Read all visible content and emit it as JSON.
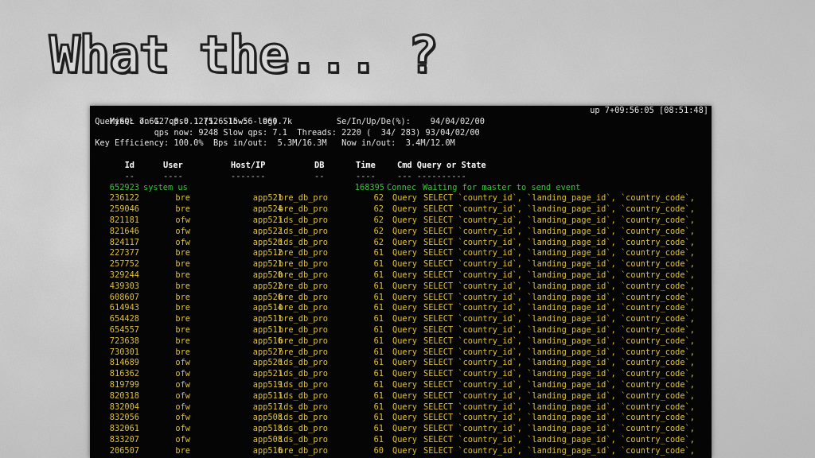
{
  "slide": {
    "title": "What the... ?"
  },
  "terminal": {
    "header": {
      "line1_left": "MySQL on 127.0.0.1 (5.6.15-56-log)",
      "line1_right": "up 7+09:56:05 [08:51:48]",
      "line2": " Queries: 7.6G  qps: 12712 Slow:   960.7k         Se/In/Up/De(%):    94/04/02/00",
      "line3": "             qps now: 9248 Slow qps: 7.1  Threads: 2220 (  34/ 283) 93/04/02/00",
      "line4": " Key Efficiency: 100.0%  Bps in/out:  5.3M/16.3M   Now in/out:  3.4M/12.0M"
    },
    "columns": {
      "id": "Id",
      "user": "User",
      "host": "Host/IP",
      "db": "DB",
      "time": "Time",
      "cmd_state": "Cmd Query or State"
    },
    "separators": {
      "id": "--",
      "user": "----",
      "host": "-------",
      "db": "--",
      "time": "----",
      "cmd_state": "--- ----------"
    },
    "system_row": {
      "id": "652923",
      "user": "system us",
      "time": "168395",
      "cmd": "Connec",
      "state": "Waiting for master to send event"
    },
    "rows": [
      {
        "id": "236122",
        "user": "bre",
        "host": "app521",
        "db": "bre_db_pro",
        "time": "62",
        "cmd": "Query",
        "query": "SELECT `country_id`, `landing_page_id`, `country_code`,"
      },
      {
        "id": "259046",
        "user": "bre",
        "host": "app524",
        "db": "bre_db_pro",
        "time": "62",
        "cmd": "Query",
        "query": "SELECT `country_id`, `landing_page_id`, `country_code`,"
      },
      {
        "id": "821181",
        "user": "ofw",
        "host": "app521",
        "db": "ids_db_pro",
        "time": "62",
        "cmd": "Query",
        "query": "SELECT `country_id`, `landing_page_id`, `country_code`,"
      },
      {
        "id": "821646",
        "user": "ofw",
        "host": "app522",
        "db": "ids_db_pro",
        "time": "62",
        "cmd": "Query",
        "query": "SELECT `country_id`, `landing_page_id`, `country_code`,"
      },
      {
        "id": "824117",
        "user": "ofw",
        "host": "app520",
        "db": "ids_db_pro",
        "time": "62",
        "cmd": "Query",
        "query": "SELECT `country_id`, `landing_page_id`, `country_code`,"
      },
      {
        "id": "227377",
        "user": "bre",
        "host": "app512",
        "db": "bre_db_pro",
        "time": "61",
        "cmd": "Query",
        "query": "SELECT `country_id`, `landing_page_id`, `country_code`,"
      },
      {
        "id": "257752",
        "user": "bre",
        "host": "app521",
        "db": "bre_db_pro",
        "time": "61",
        "cmd": "Query",
        "query": "SELECT `country_id`, `landing_page_id`, `country_code`,"
      },
      {
        "id": "329244",
        "user": "bre",
        "host": "app520",
        "db": "bre_db_pro",
        "time": "61",
        "cmd": "Query",
        "query": "SELECT `country_id`, `landing_page_id`, `country_code`,"
      },
      {
        "id": "439303",
        "user": "bre",
        "host": "app522",
        "db": "bre_db_pro",
        "time": "61",
        "cmd": "Query",
        "query": "SELECT `country_id`, `landing_page_id`, `country_code`,"
      },
      {
        "id": "608607",
        "user": "bre",
        "host": "app526",
        "db": "bre_db_pro",
        "time": "61",
        "cmd": "Query",
        "query": "SELECT `country_id`, `landing_page_id`, `country_code`,"
      },
      {
        "id": "614943",
        "user": "bre",
        "host": "app514",
        "db": "bre_db_pro",
        "time": "61",
        "cmd": "Query",
        "query": "SELECT `country_id`, `landing_page_id`, `country_code`,"
      },
      {
        "id": "654428",
        "user": "bre",
        "host": "app511",
        "db": "bre_db_pro",
        "time": "61",
        "cmd": "Query",
        "query": "SELECT `country_id`, `landing_page_id`, `country_code`,"
      },
      {
        "id": "654557",
        "user": "bre",
        "host": "app511",
        "db": "bre_db_pro",
        "time": "61",
        "cmd": "Query",
        "query": "SELECT `country_id`, `landing_page_id`, `country_code`,"
      },
      {
        "id": "723638",
        "user": "bre",
        "host": "app516",
        "db": "bre_db_pro",
        "time": "61",
        "cmd": "Query",
        "query": "SELECT `country_id`, `landing_page_id`, `country_code`,"
      },
      {
        "id": "730301",
        "user": "bre",
        "host": "app527",
        "db": "bre_db_pro",
        "time": "61",
        "cmd": "Query",
        "query": "SELECT `country_id`, `landing_page_id`, `country_code`,"
      },
      {
        "id": "814689",
        "user": "ofw",
        "host": "app520",
        "db": "ids_db_pro",
        "time": "61",
        "cmd": "Query",
        "query": "SELECT `country_id`, `landing_page_id`, `country_code`,"
      },
      {
        "id": "816362",
        "user": "ofw",
        "host": "app521",
        "db": "ids_db_pro",
        "time": "61",
        "cmd": "Query",
        "query": "SELECT `country_id`, `landing_page_id`, `country_code`,"
      },
      {
        "id": "819799",
        "user": "ofw",
        "host": "app519",
        "db": "ids_db_pro",
        "time": "61",
        "cmd": "Query",
        "query": "SELECT `country_id`, `landing_page_id`, `country_code`,"
      },
      {
        "id": "820318",
        "user": "ofw",
        "host": "app511",
        "db": "ids_db_pro",
        "time": "61",
        "cmd": "Query",
        "query": "SELECT `country_id`, `landing_page_id`, `country_code`,"
      },
      {
        "id": "832004",
        "user": "ofw",
        "host": "app517",
        "db": "ids_db_pro",
        "time": "61",
        "cmd": "Query",
        "query": "SELECT `country_id`, `landing_page_id`, `country_code`,"
      },
      {
        "id": "832056",
        "user": "ofw",
        "host": "app508",
        "db": "ids_db_pro",
        "time": "61",
        "cmd": "Query",
        "query": "SELECT `country_id`, `landing_page_id`, `country_code`,"
      },
      {
        "id": "832061",
        "user": "ofw",
        "host": "app518",
        "db": "ids_db_pro",
        "time": "61",
        "cmd": "Query",
        "query": "SELECT `country_id`, `landing_page_id`, `country_code`,"
      },
      {
        "id": "833207",
        "user": "ofw",
        "host": "app508",
        "db": "ids_db_pro",
        "time": "61",
        "cmd": "Query",
        "query": "SELECT `country_id`, `landing_page_id`, `country_code`,"
      },
      {
        "id": "206507",
        "user": "bre",
        "host": "app516",
        "db": "bre_db_pro",
        "time": "60",
        "cmd": "Query",
        "query": "SELECT `country_id`, `landing_page_id`, `country_code`,"
      }
    ],
    "colors": {
      "background": "#050505",
      "query_rows": "#e0c232",
      "system_row": "#37c837",
      "header_text": "#e8e8e8"
    }
  }
}
